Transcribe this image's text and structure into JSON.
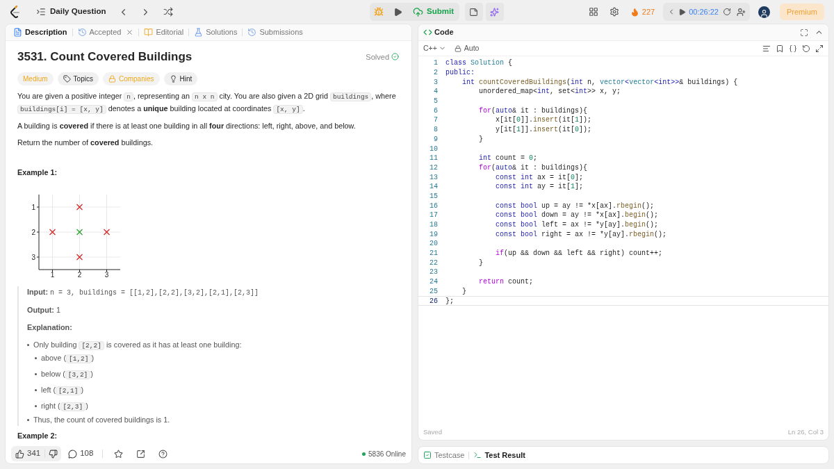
{
  "top_bar": {
    "title": "Daily Question",
    "submit": "Submit",
    "streak": "227",
    "timer": "00:26:22",
    "premium": "Premium"
  },
  "description_tabs": [
    {
      "label": "Description",
      "selected": true,
      "closable": false
    },
    {
      "label": "Accepted",
      "selected": false,
      "closable": true
    },
    {
      "label": "Editorial",
      "selected": false,
      "closable": false
    },
    {
      "label": "Solutions",
      "selected": false,
      "closable": false
    },
    {
      "label": "Submissions",
      "selected": false,
      "closable": false
    }
  ],
  "problem": {
    "title": "3531. Count Covered Buildings",
    "status": "Solved",
    "tags": [
      {
        "label": "Medium",
        "kind": "difficulty"
      },
      {
        "label": "Topics",
        "kind": "topics"
      },
      {
        "label": "Companies",
        "kind": "companies"
      },
      {
        "label": "Hint",
        "kind": "hint"
      }
    ],
    "paragraphs": [
      [
        {
          "text": "You are given a positive integer ",
          "kind": "text"
        },
        {
          "text": "n",
          "kind": "code"
        },
        {
          "text": ", representing an ",
          "kind": "text"
        },
        {
          "text": "n x n",
          "kind": "code"
        },
        {
          "text": " city. You are also given a 2D grid ",
          "kind": "text"
        },
        {
          "text": "buildings",
          "kind": "code"
        },
        {
          "text": ", where ",
          "kind": "text"
        },
        {
          "text": "buildings[i] = [x, y]",
          "kind": "code"
        },
        {
          "text": " denotes a **unique** building located at coordinates ",
          "kind": "text"
        },
        {
          "text": "[x, y]",
          "kind": "code"
        },
        {
          "text": ".",
          "kind": "text"
        }
      ],
      [
        {
          "text": "A building is **covered** if there is at least one building in all **four** directions: left, right, above, and below.",
          "kind": "text"
        }
      ],
      [
        {
          "text": "Return the number of **covered** buildings.",
          "kind": "text"
        }
      ]
    ],
    "example": {
      "heading": "Example 1:",
      "chart_data": {
        "type": "scatter",
        "grid": true,
        "xlim": [
          0.5,
          3.5
        ],
        "ylim": [
          3.5,
          0.5
        ],
        "xticks": [
          1,
          2,
          3
        ],
        "yticks": [
          1,
          2,
          3
        ],
        "series": [
          {
            "color": "#d62728",
            "x": [
              2,
              1,
              3,
              2
            ],
            "values": [
              1,
              2,
              2,
              3
            ]
          },
          {
            "color": "#2ca02c",
            "x": [
              2
            ],
            "values": [
              2
            ]
          }
        ]
      },
      "input_label": "Input:",
      "input": "n = 3, buildings = [[1,2],[2,2],[3,2],[2,1],[2,3]]",
      "output_label": "Output:",
      "output": "1",
      "explanation_label": "Explanation:",
      "explanation": [
        {
          "segments": [
            {
              "text": "Only building ",
              "kind": "text"
            },
            {
              "text": "[2,2]",
              "kind": "code"
            },
            {
              "text": " is covered as it has at least one building:",
              "kind": "text"
            }
          ],
          "children": [
            {
              "segments": [
                {
                  "text": "above (",
                  "kind": "text"
                },
                {
                  "text": "[1,2]",
                  "kind": "code"
                },
                {
                  "text": ")",
                  "kind": "text"
                }
              ]
            },
            {
              "segments": [
                {
                  "text": "below (",
                  "kind": "text"
                },
                {
                  "text": "[3,2]",
                  "kind": "code"
                },
                {
                  "text": ")",
                  "kind": "text"
                }
              ]
            },
            {
              "segments": [
                {
                  "text": "left (",
                  "kind": "text"
                },
                {
                  "text": "[2,1]",
                  "kind": "code"
                },
                {
                  "text": ")",
                  "kind": "text"
                }
              ]
            },
            {
              "segments": [
                {
                  "text": "right (",
                  "kind": "text"
                },
                {
                  "text": "[2,3]",
                  "kind": "code"
                },
                {
                  "text": ")",
                  "kind": "text"
                }
              ]
            }
          ]
        },
        {
          "segments": [
            {
              "text": "Thus, the count of covered buildings is 1.",
              "kind": "text"
            }
          ]
        }
      ]
    },
    "next_heading": "Example 2:"
  },
  "footer": {
    "likes": "341",
    "comments": "108",
    "online": "5836 Online"
  },
  "code_panel": {
    "title": "Code",
    "language": "C++",
    "mode": "Auto",
    "status": "Saved",
    "cursor": "Ln 26, Col 3",
    "lines": [
      {
        "number": "1",
        "current": false,
        "tokens": [
          {
            "text": "class",
            "kind": "keyword"
          },
          {
            "text": " Solution",
            "kind": "type"
          },
          {
            "text": " {",
            "kind": "plain"
          }
        ]
      },
      {
        "number": "2",
        "current": false,
        "tokens": [
          {
            "text": "public:",
            "kind": "keyword"
          }
        ]
      },
      {
        "number": "3",
        "current": false,
        "tokens": [
          {
            "text": "    int",
            "kind": "keyword"
          },
          {
            "text": " countCoveredBuildings",
            "kind": "function"
          },
          {
            "text": "(",
            "kind": "plain"
          },
          {
            "text": "int",
            "kind": "keyword"
          },
          {
            "text": " n, ",
            "kind": "plain"
          },
          {
            "text": "vector",
            "kind": "type"
          },
          {
            "text": "<",
            "kind": "keyword"
          },
          {
            "text": "vector",
            "kind": "type"
          },
          {
            "text": "<",
            "kind": "keyword"
          },
          {
            "text": "int",
            "kind": "keyword"
          },
          {
            "text": ">>",
            "kind": "keyword"
          },
          {
            "text": "& buildings) {",
            "kind": "plain"
          }
        ]
      },
      {
        "number": "4",
        "current": false,
        "tokens": [
          {
            "text": "        unordered_map<",
            "kind": "plain"
          },
          {
            "text": "int",
            "kind": "keyword"
          },
          {
            "text": ", set<",
            "kind": "plain"
          },
          {
            "text": "int",
            "kind": "keyword"
          },
          {
            "text": ">> x, y;",
            "kind": "plain"
          }
        ]
      },
      {
        "number": "5",
        "current": false
      },
      {
        "number": "6",
        "current": false,
        "tokens": [
          {
            "text": "        for",
            "kind": "control"
          },
          {
            "text": "(",
            "kind": "plain"
          },
          {
            "text": "auto",
            "kind": "keyword"
          },
          {
            "text": "& it : buildings){",
            "kind": "plain"
          }
        ]
      },
      {
        "number": "7",
        "current": false,
        "tokens": [
          {
            "text": "            x[it[",
            "kind": "plain"
          },
          {
            "text": "0",
            "kind": "number"
          },
          {
            "text": "]].",
            "kind": "plain"
          },
          {
            "text": "insert",
            "kind": "function"
          },
          {
            "text": "(it[",
            "kind": "plain"
          },
          {
            "text": "1",
            "kind": "number"
          },
          {
            "text": "]);",
            "kind": "plain"
          }
        ]
      },
      {
        "number": "8",
        "current": false,
        "tokens": [
          {
            "text": "            y[it[",
            "kind": "plain"
          },
          {
            "text": "1",
            "kind": "number"
          },
          {
            "text": "]].",
            "kind": "plain"
          },
          {
            "text": "insert",
            "kind": "function"
          },
          {
            "text": "(it[",
            "kind": "plain"
          },
          {
            "text": "0",
            "kind": "number"
          },
          {
            "text": "]);",
            "kind": "plain"
          }
        ]
      },
      {
        "number": "9",
        "current": false,
        "tokens": [
          {
            "text": "        }",
            "kind": "plain"
          }
        ]
      },
      {
        "number": "10",
        "current": false
      },
      {
        "number": "11",
        "current": false,
        "tokens": [
          {
            "text": "        int",
            "kind": "keyword"
          },
          {
            "text": " count = ",
            "kind": "plain"
          },
          {
            "text": "0",
            "kind": "number"
          },
          {
            "text": ";",
            "kind": "plain"
          }
        ]
      },
      {
        "number": "12",
        "current": false,
        "tokens": [
          {
            "text": "        for",
            "kind": "control"
          },
          {
            "text": "(",
            "kind": "plain"
          },
          {
            "text": "auto",
            "kind": "keyword"
          },
          {
            "text": "& it : buildings){",
            "kind": "plain"
          }
        ]
      },
      {
        "number": "13",
        "current": false,
        "tokens": [
          {
            "text": "            const int",
            "kind": "keyword"
          },
          {
            "text": " ax = it[",
            "kind": "plain"
          },
          {
            "text": "0",
            "kind": "number"
          },
          {
            "text": "];",
            "kind": "plain"
          }
        ]
      },
      {
        "number": "14",
        "current": false,
        "tokens": [
          {
            "text": "            const int",
            "kind": "keyword"
          },
          {
            "text": " ay = it[",
            "kind": "plain"
          },
          {
            "text": "1",
            "kind": "number"
          },
          {
            "text": "];",
            "kind": "plain"
          }
        ]
      },
      {
        "number": "15",
        "current": false
      },
      {
        "number": "16",
        "current": false,
        "tokens": [
          {
            "text": "            const bool",
            "kind": "keyword"
          },
          {
            "text": " up = ay != *x[ax].",
            "kind": "plain"
          },
          {
            "text": "rbegin",
            "kind": "function"
          },
          {
            "text": "();",
            "kind": "plain"
          }
        ]
      },
      {
        "number": "17",
        "current": false,
        "tokens": [
          {
            "text": "            const bool",
            "kind": "keyword"
          },
          {
            "text": " down = ay != *x[ax].",
            "kind": "plain"
          },
          {
            "text": "begin",
            "kind": "function"
          },
          {
            "text": "();",
            "kind": "plain"
          }
        ]
      },
      {
        "number": "18",
        "current": false,
        "tokens": [
          {
            "text": "            const bool",
            "kind": "keyword"
          },
          {
            "text": " left = ax != *y[ay].",
            "kind": "plain"
          },
          {
            "text": "begin",
            "kind": "function"
          },
          {
            "text": "();",
            "kind": "plain"
          }
        ]
      },
      {
        "number": "19",
        "current": false,
        "tokens": [
          {
            "text": "            const bool",
            "kind": "keyword"
          },
          {
            "text": " right = ax != *y[ay].",
            "kind": "plain"
          },
          {
            "text": "rbegin",
            "kind": "function"
          },
          {
            "text": "();",
            "kind": "plain"
          }
        ]
      },
      {
        "number": "20",
        "current": false
      },
      {
        "number": "21",
        "current": false,
        "tokens": [
          {
            "text": "            if",
            "kind": "control"
          },
          {
            "text": "(up && down && left && right) count++;",
            "kind": "plain"
          }
        ]
      },
      {
        "number": "22",
        "current": false,
        "tokens": [
          {
            "text": "        }",
            "kind": "plain"
          }
        ]
      },
      {
        "number": "23",
        "current": false
      },
      {
        "number": "24",
        "current": false,
        "tokens": [
          {
            "text": "        return",
            "kind": "control"
          },
          {
            "text": " count;",
            "kind": "plain"
          }
        ]
      },
      {
        "number": "25",
        "current": false,
        "tokens": [
          {
            "text": "    }",
            "kind": "plain"
          }
        ]
      },
      {
        "number": "26",
        "current": true,
        "tokens": [
          {
            "text": "};",
            "kind": "plain"
          }
        ]
      }
    ]
  },
  "bottom_tabs": [
    {
      "label": "Testcase",
      "selected": false
    },
    {
      "label": "Test Result",
      "selected": true
    }
  ]
}
